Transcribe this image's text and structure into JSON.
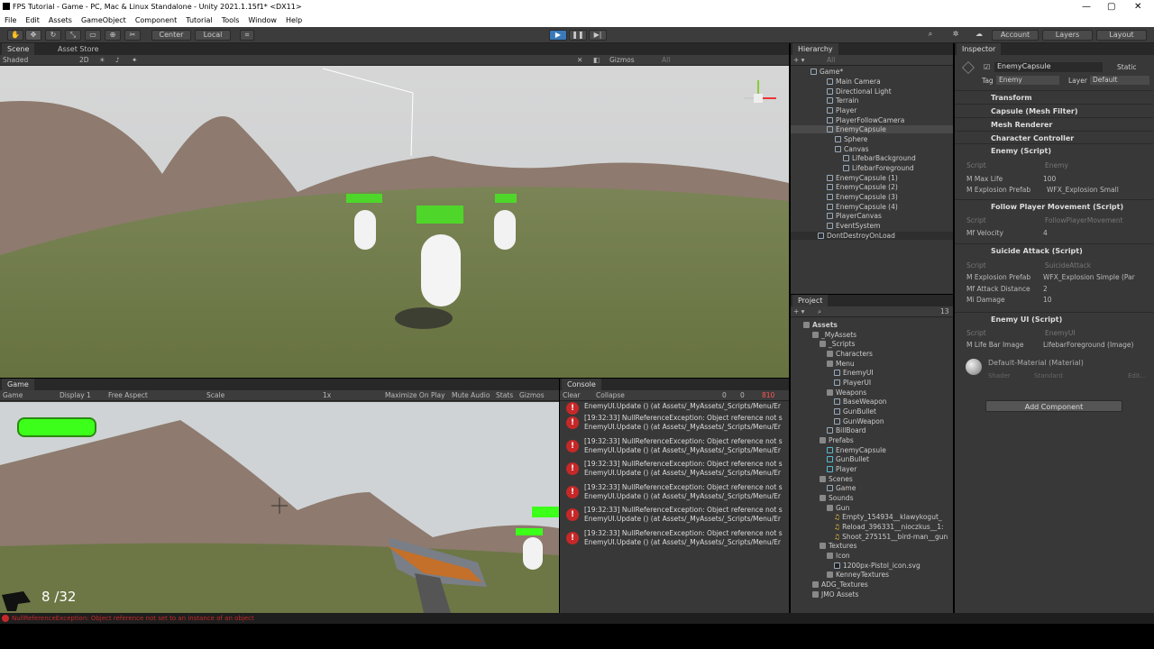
{
  "window": {
    "title": "FPS Tutorial - Game - PC, Mac & Linux Standalone - Unity 2021.1.15f1* <DX11>",
    "min": "—",
    "max": "▢",
    "close": "✕"
  },
  "menu": [
    "File",
    "Edit",
    "Assets",
    "GameObject",
    "Component",
    "Tutorial",
    "Tools",
    "Window",
    "Help"
  ],
  "toolbar": {
    "center": "Center",
    "local": "Local",
    "account": "Account",
    "layers": "Layers",
    "layout": "Layout"
  },
  "scene": {
    "tabs": [
      "Scene",
      "Asset Store"
    ],
    "shading": "Shaded",
    "mode2d": "2D",
    "gizmos": "Gizmos",
    "search_placeholder": "All"
  },
  "game": {
    "tab": "Game",
    "mode": "Game",
    "display": "Display 1",
    "aspect": "Free Aspect",
    "scale_label": "Scale",
    "scale_value": "1x",
    "maximize": "Maximize On Play",
    "mute": "Mute Audio",
    "stats": "Stats",
    "gizmos": "Gizmos",
    "ammo": "8 /32"
  },
  "console": {
    "tab": "Console",
    "clear": "Clear",
    "collapse": "Collapse",
    "warn_count": "0",
    "log_count": "0",
    "err_count": "810",
    "entries": [
      {
        "l1": "",
        "l2": "EnemyUI.Update () (at Assets/_MyAssets/_Scripts/Menu/Er"
      },
      {
        "l1": "[19:32:33] NullReferenceException: Object reference not s",
        "l2": "EnemyUI.Update () (at Assets/_MyAssets/_Scripts/Menu/Er"
      },
      {
        "l1": "[19:32:33] NullReferenceException: Object reference not s",
        "l2": "EnemyUI.Update () (at Assets/_MyAssets/_Scripts/Menu/Er"
      },
      {
        "l1": "[19:32:33] NullReferenceException: Object reference not s",
        "l2": "EnemyUI.Update () (at Assets/_MyAssets/_Scripts/Menu/Er"
      },
      {
        "l1": "[19:32:33] NullReferenceException: Object reference not s",
        "l2": "EnemyUI.Update () (at Assets/_MyAssets/_Scripts/Menu/Er"
      },
      {
        "l1": "[19:32:33] NullReferenceException: Object reference not s",
        "l2": "EnemyUI.Update () (at Assets/_MyAssets/_Scripts/Menu/Er"
      },
      {
        "l1": "[19:32:33] NullReferenceException: Object reference not s",
        "l2": "EnemyUI.Update () (at Assets/_MyAssets/_Scripts/Menu/Er"
      }
    ]
  },
  "hierarchy": {
    "tab": "Hierarchy",
    "search_placeholder": "All",
    "items": [
      "Game*",
      "Main Camera",
      "Directional Light",
      "Terrain",
      "Player",
      "PlayerFollowCamera",
      "EnemyCapsule",
      "Sphere",
      "Canvas",
      "LifebarBackground",
      "LifebarForeground",
      "EnemyCapsule (1)",
      "EnemyCapsule (2)",
      "EnemyCapsule (3)",
      "EnemyCapsule (4)",
      "PlayerCanvas",
      "EventSystem",
      "DontDestroyOnLoad"
    ]
  },
  "project": {
    "tab": "Project",
    "count": "13",
    "items": [
      "Assets",
      "_MyAssets",
      "_Scripts",
      "Characters",
      "Menu",
      "EnemyUI",
      "PlayerUI",
      "Weapons",
      "BaseWeapon",
      "GunBullet",
      "GunWeapon",
      "BillBoard",
      "Prefabs",
      "EnemyCapsule",
      "GunBullet",
      "Player",
      "Scenes",
      "Game",
      "Sounds",
      "Gun",
      "Empty_154934__klawykogut_",
      "Reload_396331__nioczkus__1:",
      "Shoot_275151__bird-man__gun",
      "Textures",
      "Icon",
      "1200px-Pistol_icon.svg",
      "KenneyTextures",
      "ADG_Textures",
      "JMO Assets"
    ]
  },
  "inspector": {
    "tab": "Inspector",
    "name": "EnemyCapsule",
    "static": "Static",
    "tag_label": "Tag",
    "tag": "Enemy",
    "layer_label": "Layer",
    "layer": "Default",
    "components": [
      "Transform",
      "Capsule (Mesh Filter)",
      "Mesh Renderer",
      "Character Controller",
      "Enemy (Script)",
      "Follow Player Movement (Script)",
      "Suicide Attack (Script)",
      "Enemy UI (Script)"
    ],
    "enemy": {
      "script_label": "Script",
      "script": "Enemy",
      "maxlife_label": "M Max Life",
      "maxlife": "100",
      "explosion_label": "M Explosion Prefab",
      "explosion": "WFX_Explosion Small"
    },
    "follow": {
      "script_label": "Script",
      "script": "FollowPlayerMovement",
      "velocity_label": "Mf Velocity",
      "velocity": "4"
    },
    "suicide": {
      "script_label": "Script",
      "script": "SuicideAttack",
      "explosion_label": "M Explosion Prefab",
      "explosion": "WFX_Explosion Simple (Par",
      "distance_label": "Mf Attack Distance",
      "distance": "2",
      "damage_label": "Mi Damage",
      "damage": "10"
    },
    "enemyui": {
      "script_label": "Script",
      "script": "EnemyUI",
      "lifebar_label": "M Life Bar Image",
      "lifebar": "LifebarForeground (Image)"
    },
    "material": "Default-Material (Material)",
    "shader_label": "Shader",
    "shader": "Standard",
    "edit": "Edit...",
    "add_component": "Add Component"
  },
  "status": "NullReferenceException: Object reference not set to an instance of an object",
  "colors": {
    "accent": "#3a79bb",
    "error": "#c62828",
    "health": "#3cff1a"
  }
}
